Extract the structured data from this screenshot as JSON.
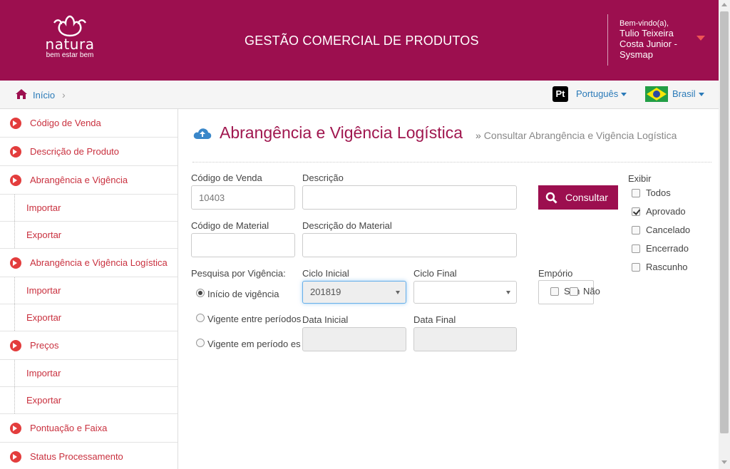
{
  "header": {
    "logo_word": "natura",
    "logo_tagline": "bem estar bem",
    "title": "GESTÃO COMERCIAL DE PRODUTOS",
    "user_welcome": "Bem-vindo(a),",
    "user_name": "Tulio Teixeira Costa Junior - Sysmap",
    "brand_color": "#9c0f4f"
  },
  "breadcrumb": {
    "home_icon": "home-icon",
    "home_label": "Início",
    "separator": "›",
    "language_icon": "Pt",
    "language_label": "Português",
    "country_label": "Brasil",
    "country_icon": "brazil-flag-icon"
  },
  "sidebar": {
    "items": [
      {
        "label": "Código de Venda",
        "type": "top"
      },
      {
        "label": "Descrição de Produto",
        "type": "top"
      },
      {
        "label": "Abrangência e Vigência",
        "type": "top"
      },
      {
        "label": "Importar",
        "type": "sub"
      },
      {
        "label": "Exportar",
        "type": "sub"
      },
      {
        "label": "Abrangência e Vigência Logística",
        "type": "top"
      },
      {
        "label": "Importar",
        "type": "sub"
      },
      {
        "label": "Exportar",
        "type": "sub"
      },
      {
        "label": "Preços",
        "type": "top"
      },
      {
        "label": "Importar",
        "type": "sub"
      },
      {
        "label": "Exportar",
        "type": "sub"
      },
      {
        "label": "Pontuação e Faixa",
        "type": "top"
      },
      {
        "label": "Status Processamento",
        "type": "top"
      }
    ]
  },
  "main": {
    "page_icon": "cloud-upload-icon",
    "page_title": "Abrangência e Vigência Logística",
    "page_sub_sep": "»",
    "page_subtitle": "Consultar Abrangência e Vigência Logística",
    "form": {
      "codigo_venda_label": "Código de Venda",
      "codigo_venda_value": "10403",
      "descricao_label": "Descrição",
      "descricao_value": "",
      "codigo_material_label": "Código de Material",
      "codigo_material_value": "",
      "descricao_material_label": "Descrição do Material",
      "descricao_material_value": "",
      "pesquisa_label": "Pesquisa por Vigência:",
      "radio_inicio": "Início de vigência",
      "radio_vigente_entre": "Vigente entre períodos",
      "radio_vigente_em": "Vigente em período es",
      "ciclo_inicial_label": "Ciclo Inicial",
      "ciclo_inicial_value": "201819",
      "ciclo_final_label": "Ciclo Final",
      "ciclo_final_value": "",
      "data_inicial_label": "Data Inicial",
      "data_final_label": "Data Final",
      "emporio_label": "Empório",
      "emporio_sim": "Sim",
      "emporio_nao": "Não",
      "consultar_label": "Consultar",
      "exibir_label": "Exibir",
      "exibir_options": [
        {
          "label": "Todos",
          "checked": false
        },
        {
          "label": "Aprovado",
          "checked": true
        },
        {
          "label": "Cancelado",
          "checked": false
        },
        {
          "label": "Encerrado",
          "checked": false
        },
        {
          "label": "Rascunho",
          "checked": false
        }
      ]
    }
  }
}
